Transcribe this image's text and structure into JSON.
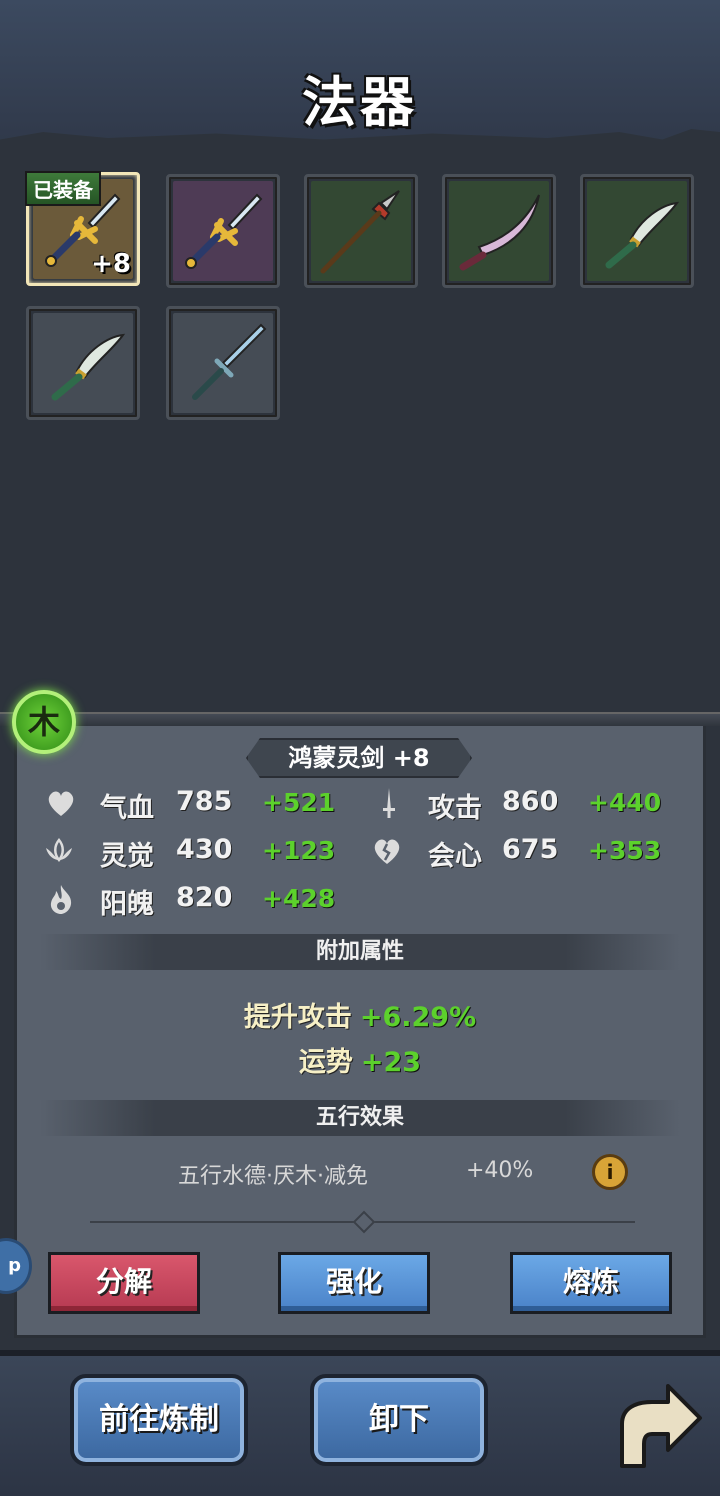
{
  "header": {
    "title": "法器"
  },
  "slots": [
    {
      "equipped": true,
      "equip_tag": "已装备",
      "level": "+8",
      "bg": "#6b5a3a",
      "weapon": "golden-sword"
    },
    {
      "equipped": false,
      "bg": "#4e3b55",
      "weapon": "golden-sword"
    },
    {
      "equipped": false,
      "bg": "#334833",
      "weapon": "spear"
    },
    {
      "equipped": false,
      "bg": "#334833",
      "weapon": "curved-blade"
    },
    {
      "equipped": false,
      "bg": "#334833",
      "weapon": "jade-dagger"
    },
    {
      "equipped": false,
      "bg": "#454c55",
      "weapon": "jade-dagger"
    },
    {
      "equipped": false,
      "bg": "#454c55",
      "weapon": "plain-sword"
    }
  ],
  "element": {
    "label": "木",
    "color": "#5cc12c"
  },
  "item": {
    "name": "鸿蒙灵剑 +8"
  },
  "stats": [
    {
      "icon": "heart-icon",
      "label": "气血",
      "value": "785",
      "bonus": "+521"
    },
    {
      "icon": "sword-icon",
      "label": "攻击",
      "value": "860",
      "bonus": "+440"
    },
    {
      "icon": "lotus-icon",
      "label": "灵觉",
      "value": "430",
      "bonus": "+123"
    },
    {
      "icon": "broken-heart-icon",
      "label": "会心",
      "value": "675",
      "bonus": "+353"
    },
    {
      "icon": "flame-icon",
      "label": "阳魄",
      "value": "820",
      "bonus": "+428"
    }
  ],
  "extra": {
    "title": "附加属性",
    "attrs": [
      {
        "label": "提升攻击",
        "value": "+6.29%"
      },
      {
        "label": "运势",
        "value": "+23"
      }
    ]
  },
  "wuxing": {
    "title": "五行效果",
    "desc": "五行水德·厌木·减免",
    "value": "+40%",
    "info": "i"
  },
  "actions": {
    "decompose": "分解",
    "enhance": "强化",
    "smelt": "熔炼"
  },
  "side_tab": "p",
  "footer": {
    "forge": "前往炼制",
    "unequip": "卸下"
  },
  "colors": {
    "bonus_green": "#5cd12c",
    "red_button": "#c9475e",
    "blue_button": "#5a93d6"
  }
}
